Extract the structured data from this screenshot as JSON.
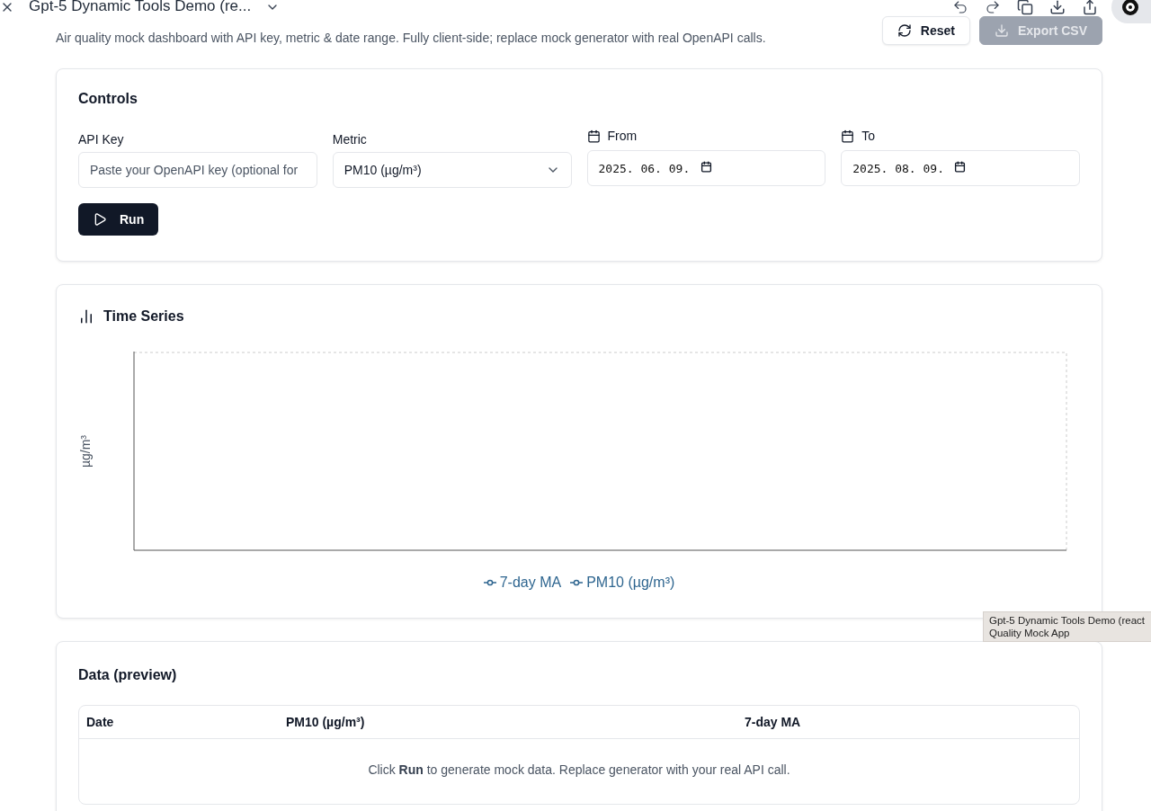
{
  "top_bar": {
    "title": "Gpt-5 Dynamic Tools Demo (re..."
  },
  "header": {
    "description": "Air quality mock dashboard with API key, metric & date range. Fully client-side; replace mock generator with real OpenAPI calls.",
    "buttons": [
      {
        "kind": "reset",
        "label": "Reset",
        "disabled": false
      },
      {
        "kind": "export",
        "label": "Export CSV",
        "disabled": true
      }
    ]
  },
  "controls": {
    "title": "Controls",
    "fields": [
      {
        "kind": "text",
        "label": "API Key",
        "placeholder": "Paste your OpenAPI key (optional for"
      },
      {
        "kind": "select",
        "label": "Metric",
        "value": "PM10 (µg/m³)"
      },
      {
        "kind": "date",
        "label": "From",
        "value": "2025. 06. 09."
      },
      {
        "kind": "date",
        "label": "To",
        "value": "2025. 08. 09."
      }
    ],
    "run_button": "Run"
  },
  "time_series": {
    "title": "Time Series",
    "ylabel": "µg/m³",
    "legend": [
      {
        "label": "7-day MA"
      },
      {
        "label": "PM10 (µg/m³)"
      }
    ]
  },
  "data_preview": {
    "title": "Data (preview)",
    "columns": [
      "Date",
      "PM10 (µg/m³)",
      "7-day MA"
    ],
    "empty_message": "Click **Run** to generate mock data. Replace generator with your real API call."
  },
  "tooltip": {
    "lines": [
      "Gpt-5 Dynamic Tools Demo (react",
      "Quality Mock App"
    ]
  }
}
